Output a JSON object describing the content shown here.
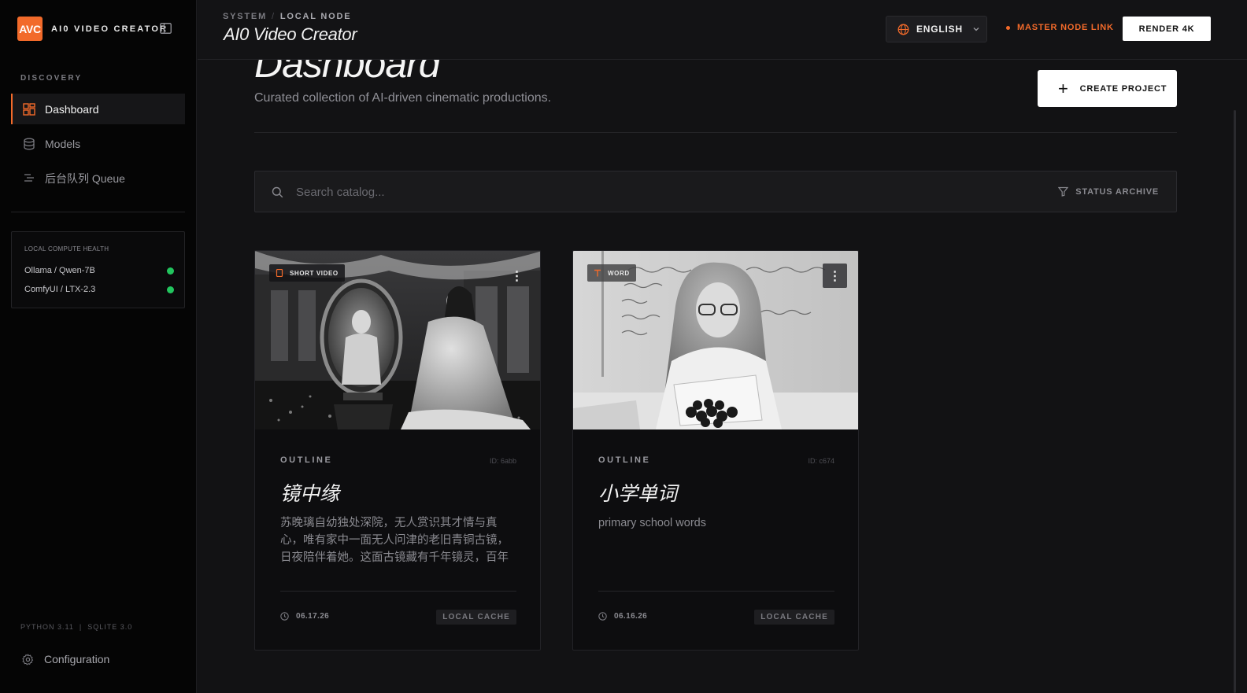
{
  "sidebar": {
    "logo_text": "AVC",
    "brand_name": "AI0 VIDEO CREATOR",
    "section_label": "DISCOVERY",
    "nav": [
      {
        "label": "Dashboard",
        "icon": "dashboard-icon"
      },
      {
        "label": "Models",
        "icon": "database-icon"
      },
      {
        "label": "后台队列 Queue",
        "icon": "queue-icon"
      }
    ],
    "health": {
      "title": "LOCAL COMPUTE HEALTH",
      "items": [
        {
          "name": "Ollama / Qwen-7B",
          "status": "online"
        },
        {
          "name": "ComfyUI / LTX-2.3",
          "status": "online"
        }
      ]
    },
    "version": "PYTHON 3.11  |  SQLITE 3.0",
    "config_label": "Configuration"
  },
  "header": {
    "breadcrumb_root": "SYSTEM",
    "breadcrumb_sep": "/",
    "breadcrumb_current": "LOCAL NODE",
    "title": "AI0 Video Creator",
    "language": "ENGLISH",
    "master_link": "MASTER NODE LINK",
    "render_label": "RENDER 4K"
  },
  "main": {
    "title": "Dashboard",
    "subtitle": "Curated collection of AI-driven cinematic productions.",
    "create_label": "CREATE PROJECT",
    "search_placeholder": "Search catalog...",
    "status_archive": "STATUS ARCHIVE"
  },
  "cards": [
    {
      "tag": "SHORT VIDEO",
      "label": "OUTLINE",
      "id": "ID: 6abb",
      "title": "镜中缘",
      "description": "苏晚璃自幼独处深院，无人赏识其才情与真心，唯有家中一面无人问津的老旧青铜古镜，日夜陪伴着她。这面古镜藏有千年镜灵，百年沉寂不…",
      "date": "06.17.26",
      "badge": "LOCAL CACHE"
    },
    {
      "tag": "WORD",
      "label": "OUTLINE",
      "id": "ID: c674",
      "title": "小学单词",
      "description": "primary school words",
      "date": "06.16.26",
      "badge": "LOCAL CACHE"
    }
  ],
  "colors": {
    "accent": "#f26a2a",
    "online": "#22c55e",
    "background": "#121214",
    "sidebar": "#050505"
  }
}
